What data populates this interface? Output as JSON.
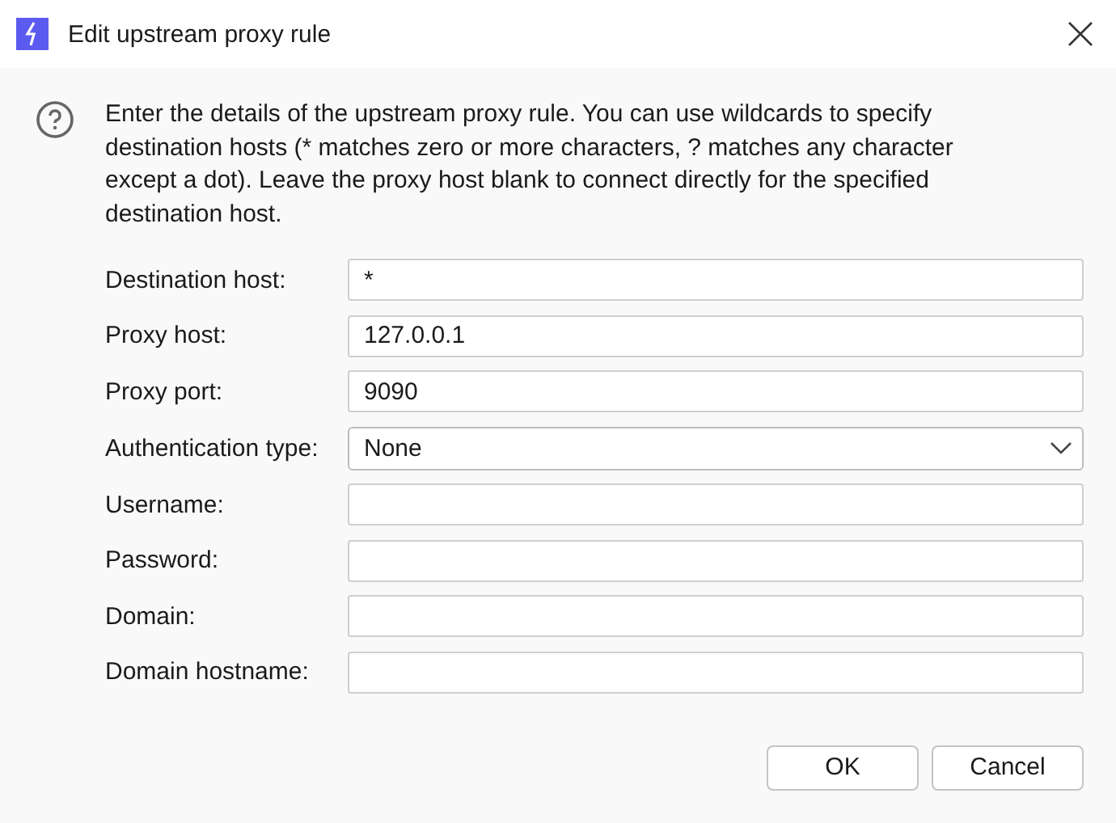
{
  "window": {
    "title": "Edit upstream proxy rule"
  },
  "description": "Enter the details of the upstream proxy rule. You can use wildcards to specify destination hosts (* matches zero or more characters, ? matches any character except a dot). Leave the proxy host blank to connect directly for the specified destination host.",
  "fields": [
    {
      "label": "Destination host:",
      "kind": "text",
      "value": "*"
    },
    {
      "label": "Proxy host:",
      "kind": "text",
      "value": "127.0.0.1"
    },
    {
      "label": "Proxy port:",
      "kind": "text",
      "value": "9090"
    },
    {
      "label": "Authentication type:",
      "kind": "dropdown",
      "value": "None"
    },
    {
      "label": "Username:",
      "kind": "text"
    },
    {
      "label": "Password:",
      "kind": "text"
    },
    {
      "label": "Domain:",
      "kind": "text"
    },
    {
      "label": "Domain hostname:",
      "kind": "text"
    }
  ],
  "buttons": [
    "OK",
    "Cancel"
  ]
}
